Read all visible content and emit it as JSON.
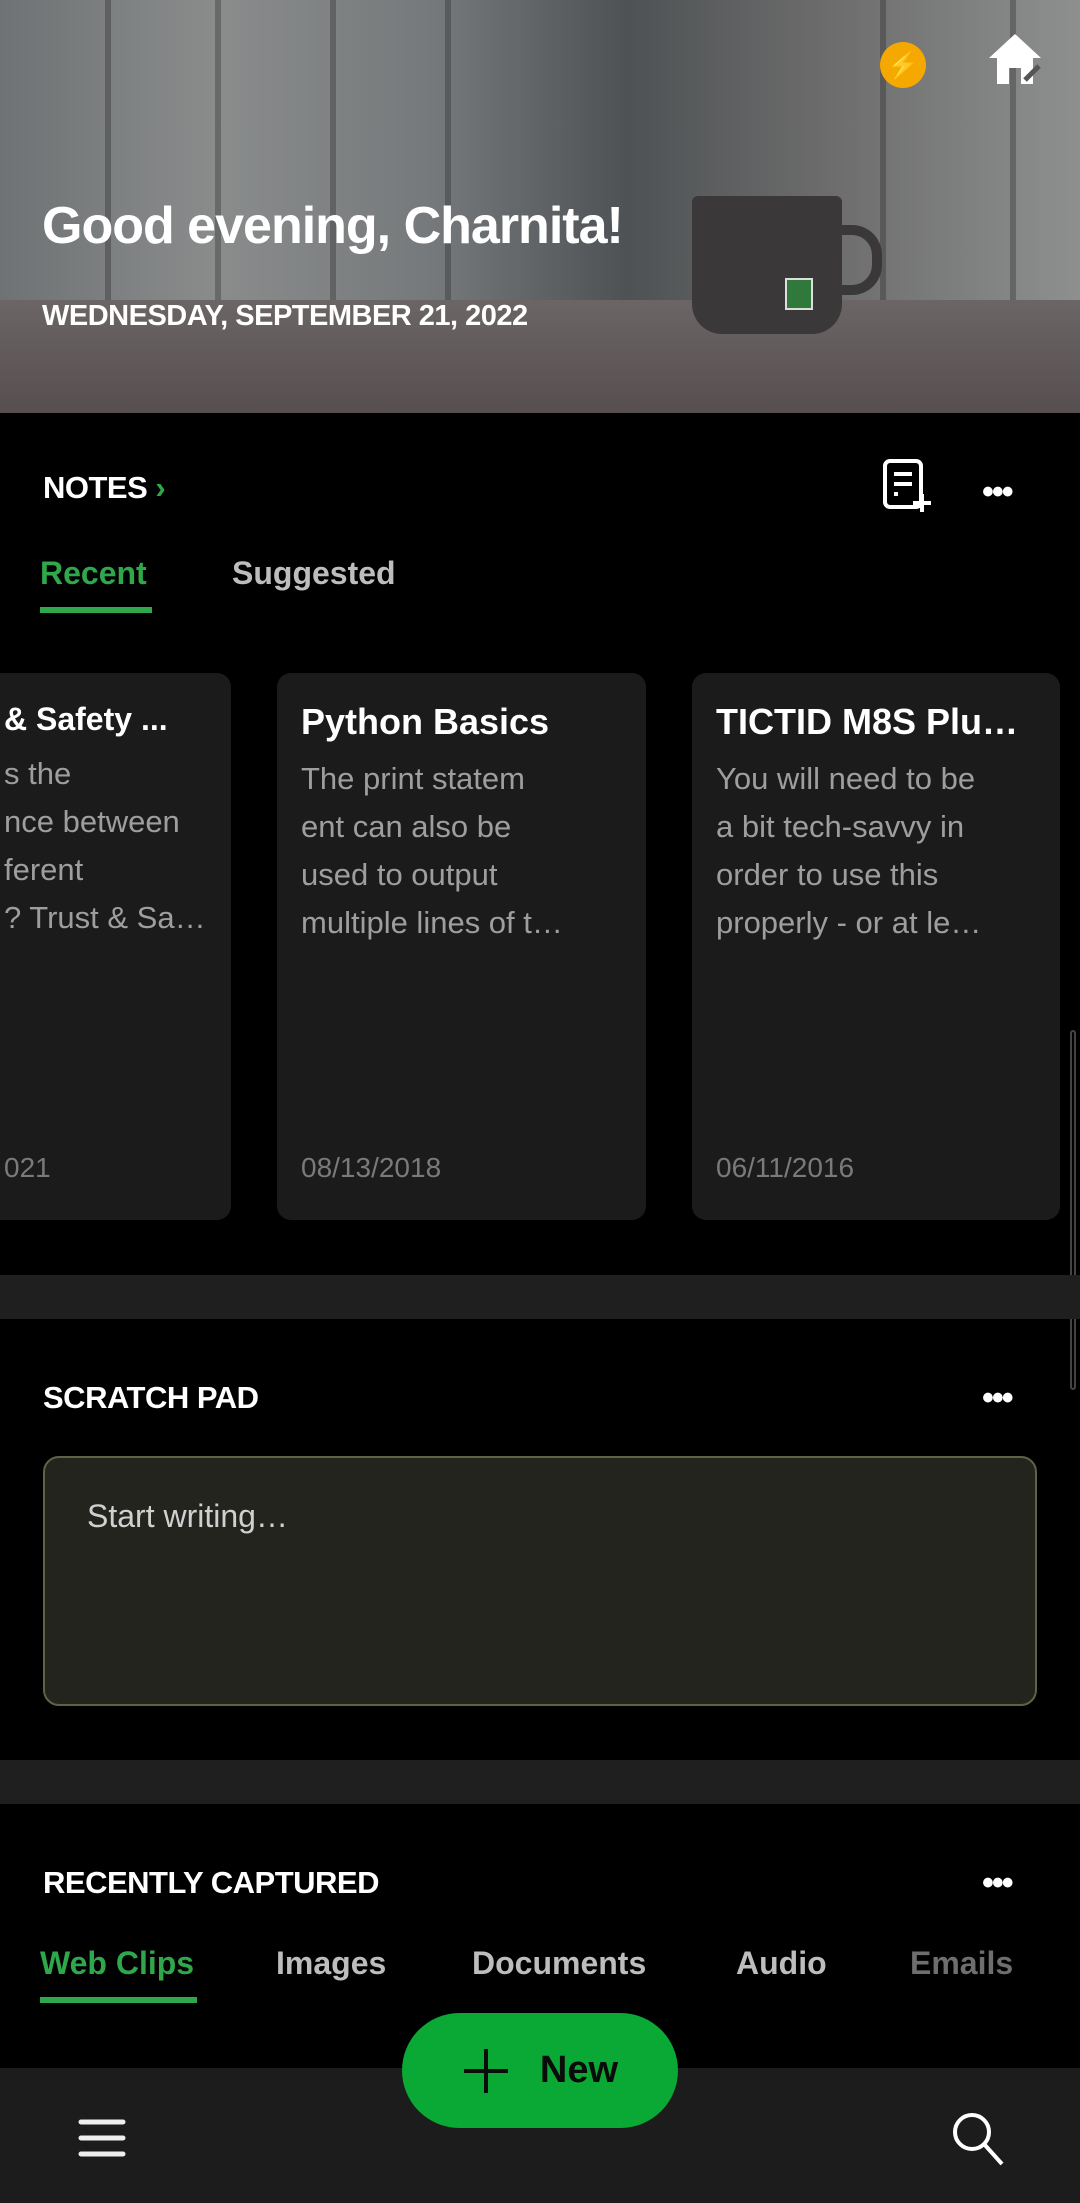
{
  "hero": {
    "greeting": "Good evening, Charnita!",
    "date": "WEDNESDAY, SEPTEMBER 21, 2022",
    "icons": [
      "lightning-icon",
      "home-edit-icon"
    ],
    "accent": "#f5a800"
  },
  "notes": {
    "title": "NOTES",
    "tabs": [
      {
        "label": "Recent",
        "active": true
      },
      {
        "label": "Suggested",
        "active": false
      }
    ],
    "cards": [
      {
        "title": "& Safety ...",
        "snippet": "s the\nnce between\nferent\n? Trust & Sa…",
        "date": "021"
      },
      {
        "title": "Python Basics",
        "snippet": "The print statem\nent can also be\nused to output\nmultiple lines of t…",
        "date": "08/13/2018"
      },
      {
        "title": "TICTID M8S Plu…",
        "snippet": "You will need to be\na bit tech-savvy in\norder to use this\nproperly - or at le…",
        "date": "06/11/2016"
      }
    ]
  },
  "scratch_pad": {
    "title": "SCRATCH PAD",
    "placeholder": "Start writing…"
  },
  "recently_captured": {
    "title": "RECENTLY CAPTURED",
    "tabs": [
      {
        "label": "Web Clips",
        "active": true
      },
      {
        "label": "Images"
      },
      {
        "label": "Documents"
      },
      {
        "label": "Audio"
      },
      {
        "label": "Emails"
      }
    ]
  },
  "bottom": {
    "new_label": "New"
  },
  "colors": {
    "accent": "#2ea84a",
    "new_button": "#0aa834"
  }
}
